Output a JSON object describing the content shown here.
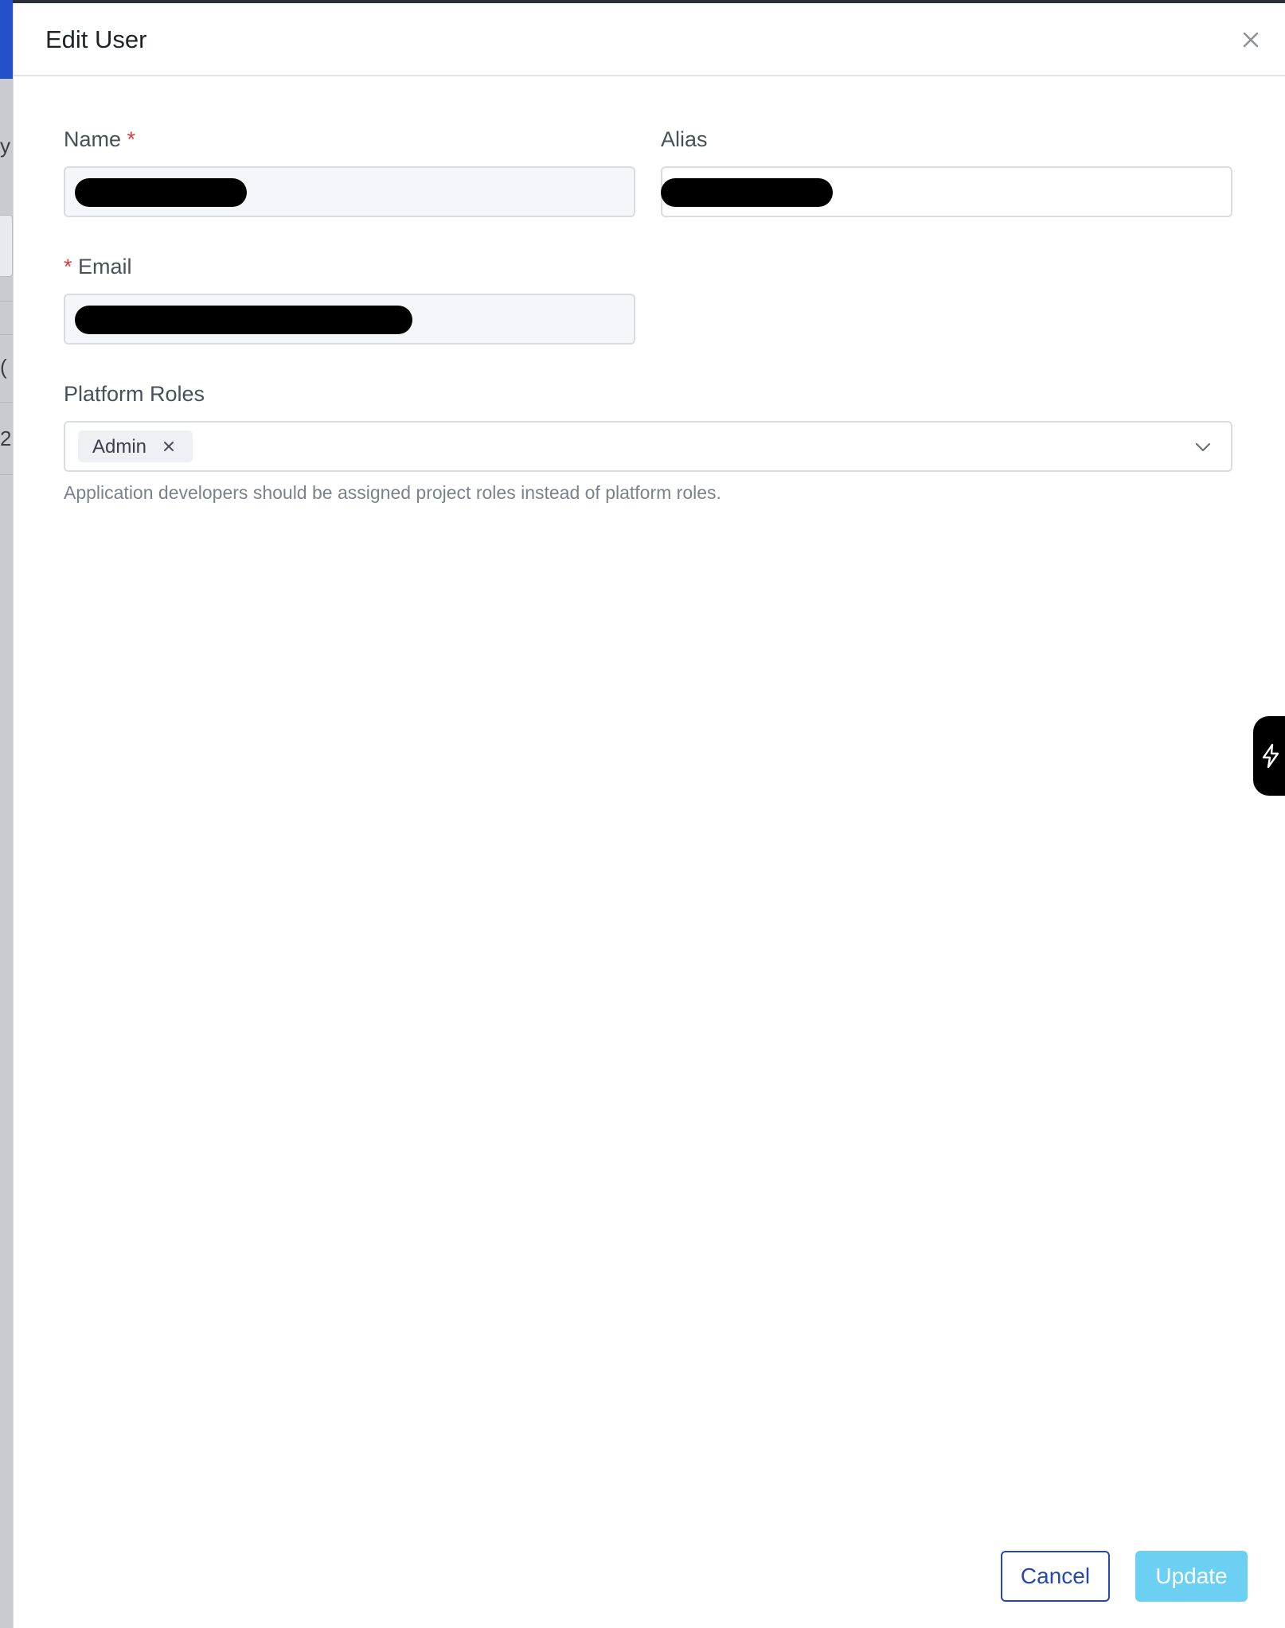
{
  "dialog": {
    "title": "Edit User",
    "close_icon": "close-icon"
  },
  "form": {
    "name_label": "Name",
    "name_required_mark": "*",
    "alias_label": "Alias",
    "email_label": "Email",
    "email_required_mark": "*",
    "roles_label": "Platform Roles",
    "roles_selected": [
      {
        "label": "Admin",
        "remove_icon": "close-icon"
      }
    ],
    "roles_dropdown_icon": "chevron-down-icon",
    "roles_help": "Application developers should be assigned project roles instead of platform roles."
  },
  "footer": {
    "cancel_label": "Cancel",
    "update_label": "Update"
  },
  "side_widget": {
    "icon": "lightning-icon"
  },
  "background": {
    "partial_chars": [
      "y",
      "(",
      "2"
    ]
  },
  "colors": {
    "primary": "#2347b8",
    "update_disabled": "#6cd0f3",
    "required": "#e03a3a",
    "brand_strip": "#2150c9"
  }
}
